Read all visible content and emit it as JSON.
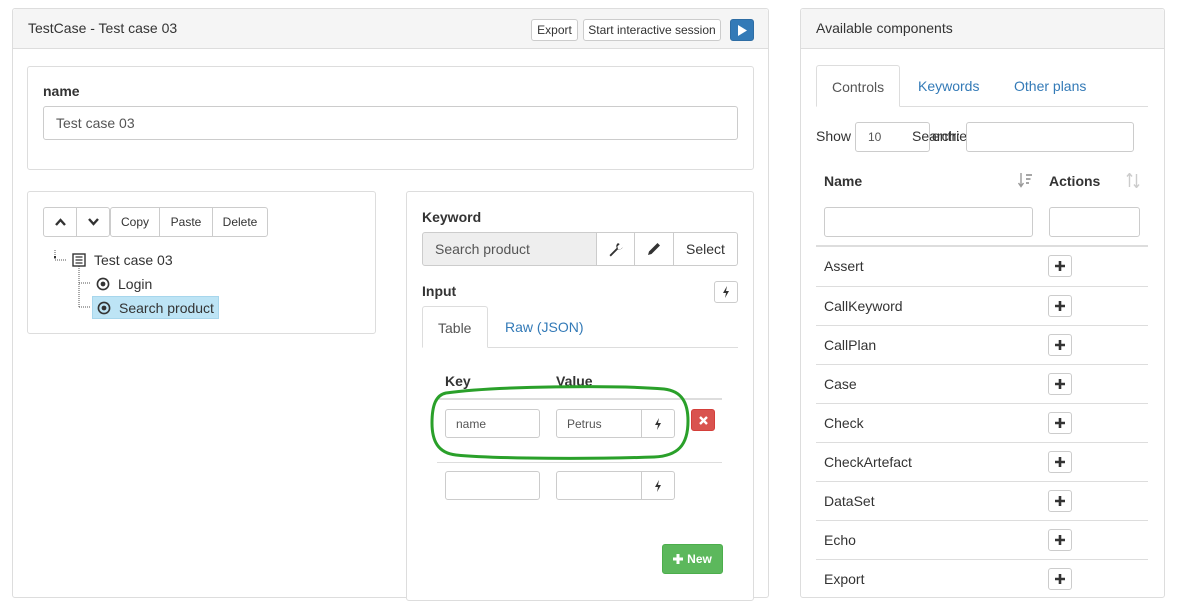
{
  "testcase": {
    "title": "TestCase - Test case 03",
    "export_label": "Export",
    "interactive_label": "Start interactive session",
    "name_label": "name",
    "name_value": "Test case 03"
  },
  "tree": {
    "copy_label": "Copy",
    "paste_label": "Paste",
    "delete_label": "Delete",
    "root": "Test case 03",
    "children": [
      "Login",
      "Search product"
    ]
  },
  "keyword": {
    "label": "Keyword",
    "value": "Search product",
    "select_label": "Select",
    "input_label": "Input",
    "tabs": [
      "Table",
      "Raw (JSON)"
    ],
    "key_header": "Key",
    "value_header": "Value",
    "rows": [
      {
        "key": "name",
        "value": "Petrus"
      }
    ],
    "new_label": "New"
  },
  "components": {
    "title": "Available components",
    "tabs": [
      "Controls",
      "Keywords",
      "Other plans"
    ],
    "show_label": "Show",
    "entries_value": "10",
    "entries_label": "entries",
    "search_label": "Search:",
    "col_name": "Name",
    "col_actions": "Actions",
    "items": [
      "Assert",
      "CallKeyword",
      "CallPlan",
      "Case",
      "Check",
      "CheckArtefact",
      "DataSet",
      "Echo",
      "Export"
    ]
  },
  "colors": {
    "primary": "#337ab7",
    "success": "#5cb85c",
    "danger": "#d9534f",
    "highlight_circle": "#2aa02a",
    "selected_node_bg": "#bde4f5"
  }
}
